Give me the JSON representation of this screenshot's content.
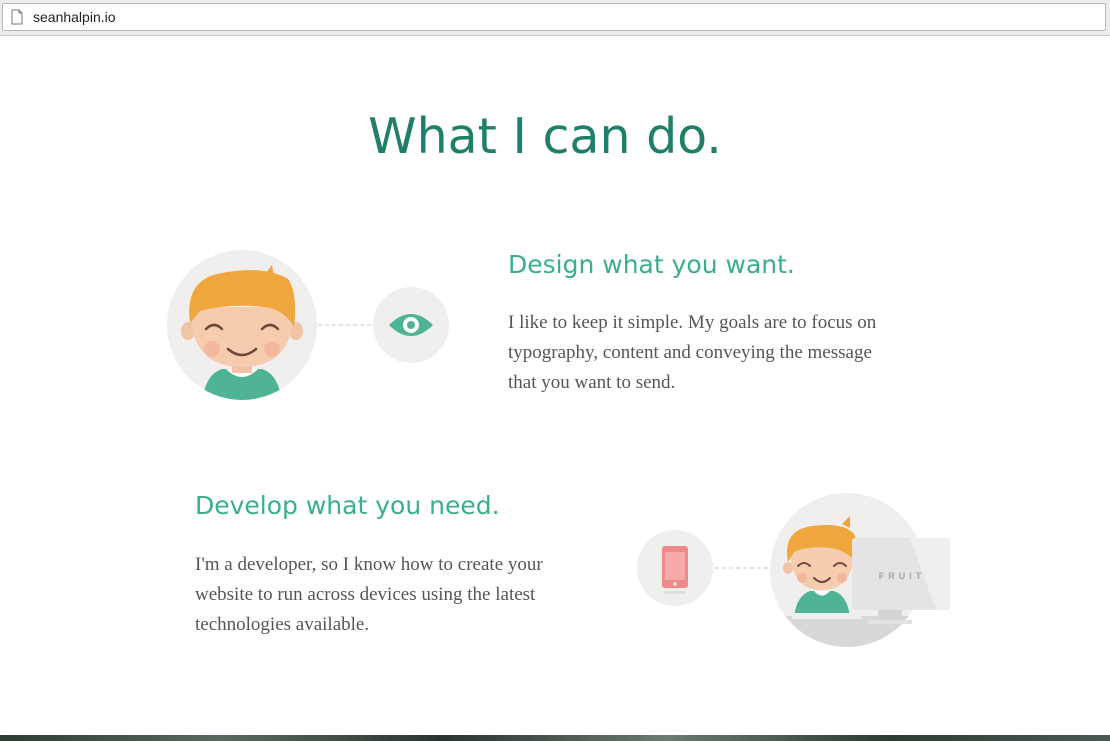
{
  "browser": {
    "url": "seanhalpin.io"
  },
  "main": {
    "title": "What I can do."
  },
  "sections": [
    {
      "heading": "Design what you want.",
      "text": "I like to keep it simple. My goals are to focus on\ntypography, content and conveying the message\nthat you want to send."
    },
    {
      "heading": "Develop what you need.",
      "text": "I'm a developer, so I know how to create your\nwebsite to run across devices using the latest\ntechnologies available."
    }
  ],
  "illustrations": {
    "monitor_label": "FRUIT"
  },
  "colors": {
    "title": "#1f7f69",
    "heading": "#3aae8f",
    "body_text": "#555555",
    "hair": "#efa63e",
    "shirt": "#4fb495",
    "circle_bg": "#f0efed"
  }
}
